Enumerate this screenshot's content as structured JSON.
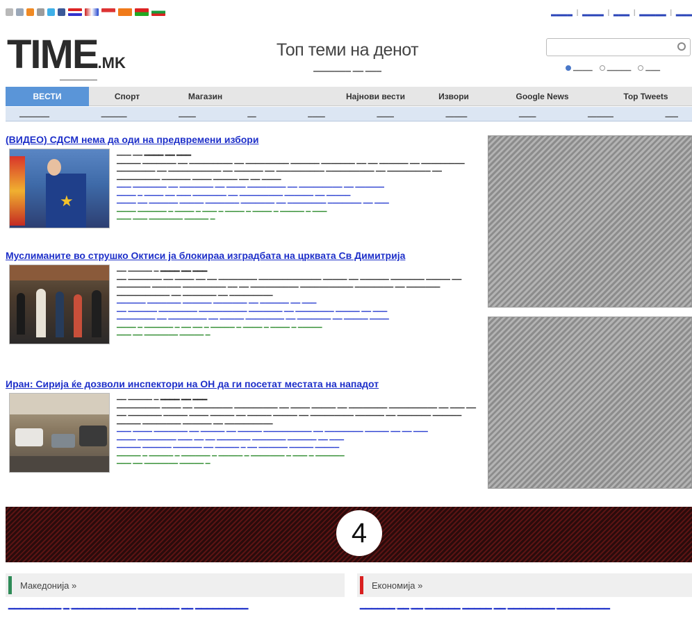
{
  "colors": {
    "link_blue": "#1d2fc9",
    "source_green": "#2e8b2e",
    "nav_active": "#5a95d8",
    "section_makedonija": "#2e8b57",
    "section_ekonomija": "#d92020"
  },
  "topbar": {
    "icons": [
      "home-icon",
      "bookmark-icon",
      "rss-icon",
      "mail-icon",
      "twitter-icon",
      "facebook-icon"
    ],
    "flags": [
      "flag-en",
      "flag-uk",
      "flag-mk",
      "flag-orange",
      "flag-red",
      "flag-bg"
    ]
  },
  "header": {
    "logo_main": "TIME",
    "logo_suffix": ".MK",
    "title": "Топ теми на денот"
  },
  "nav": {
    "tabs": [
      {
        "label": "ВЕСТИ",
        "active": true
      },
      {
        "label": "Спорт",
        "active": false
      },
      {
        "label": "Магазин",
        "active": false
      },
      {
        "label": "",
        "active": false
      },
      {
        "label": "Најнови вести",
        "active": false
      },
      {
        "label": "Извори",
        "active": false
      },
      {
        "label": "Google News",
        "active": false
      },
      {
        "label": "Top Tweets",
        "active": false
      }
    ]
  },
  "articles": [
    {
      "title": "(ВИДЕО) СДСМ нема да оди на предвремени избори"
    },
    {
      "title": "Муслиманите во струшко Октиси ја блокираа изградбата на црквата Св Димитрија"
    },
    {
      "title": "Иран: Сирија ќе дозволи инспектори на ОН да ги посетат местата на нападот"
    }
  ],
  "banner": {
    "badge": "4"
  },
  "sections": [
    {
      "label": "Македонија »"
    },
    {
      "label": "Економија »"
    }
  ]
}
